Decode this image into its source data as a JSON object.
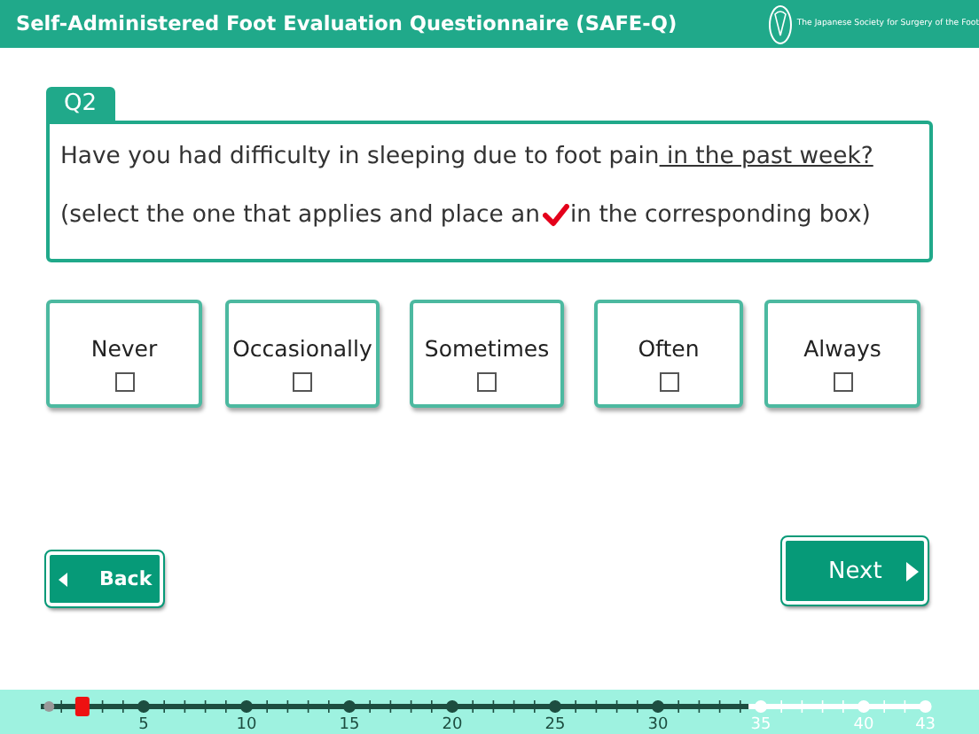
{
  "header": {
    "title": "Self-Administered Foot Evaluation Questionnaire (SAFE-Q)",
    "society": "The Japanese Society for Surgery of the Foot"
  },
  "question": {
    "number": "Q2",
    "text": "Have you had difficulty in sleeping due to foot pain",
    "emphasis": " in the past week?",
    "instruction_before": "(select the one that applies and place an",
    "instruction_after": "in the corresponding box)"
  },
  "options": [
    {
      "label": "Never",
      "checked": false
    },
    {
      "label": "Occasionally",
      "checked": false
    },
    {
      "label": "Sometimes",
      "checked": false
    },
    {
      "label": "Often",
      "checked": false
    },
    {
      "label": "Always",
      "checked": false
    }
  ],
  "back": {
    "label": "Back"
  },
  "next": {
    "label": "Next"
  },
  "progress": {
    "level": 0.047,
    "answered": {
      "level": 0.8
    },
    "labels": [
      "5",
      "10",
      "15",
      "20",
      "25",
      "30",
      "35",
      "40",
      "43"
    ]
  }
}
